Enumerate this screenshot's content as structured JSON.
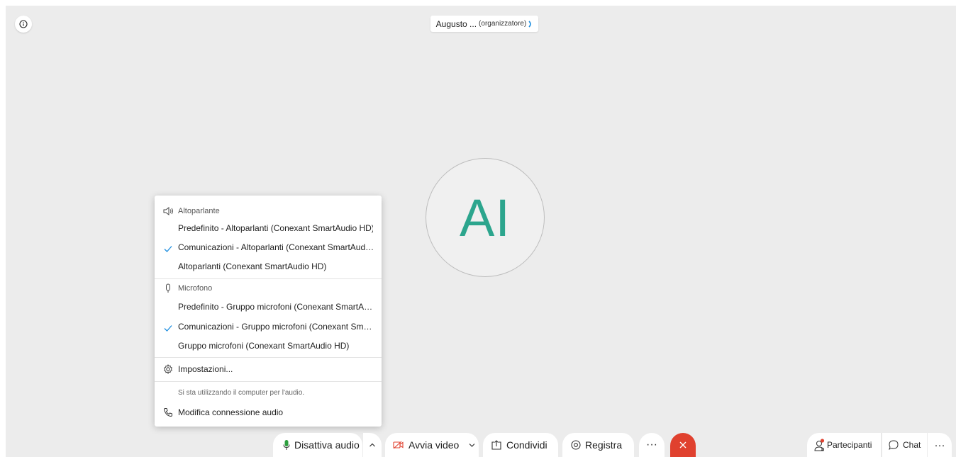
{
  "participant": {
    "name": "Augusto ...",
    "role": "(organizzatore)",
    "initials": "AI"
  },
  "audio_menu": {
    "speaker_title": "Altoparlante",
    "speakers": [
      {
        "label": "Predefinito - Altoparlanti (Conexant SmartAudio HD)",
        "selected": false
      },
      {
        "label": "Comunicazioni - Altoparlanti (Conexant SmartAud…",
        "selected": true
      },
      {
        "label": "Altoparlanti (Conexant SmartAudio HD)",
        "selected": false
      }
    ],
    "mic_title": "Microfono",
    "mics": [
      {
        "label": "Predefinito - Gruppo microfoni (Conexant SmartA…",
        "selected": false
      },
      {
        "label": "Comunicazioni - Gruppo microfoni (Conexant Sm…",
        "selected": true
      },
      {
        "label": "Gruppo microfoni (Conexant SmartAudio HD)",
        "selected": false
      }
    ],
    "settings_label": "Impostazioni...",
    "audio_note": "Si sta utilizzando il computer per l'audio.",
    "change_connection_label": "Modifica connessione audio"
  },
  "controls": {
    "mute_label": "Disattiva audio",
    "video_label": "Avvia video",
    "share_label": "Condividi",
    "record_label": "Registra",
    "more_label": "···",
    "participants_label": "Partecipanti",
    "chat_label": "Chat",
    "right_more_label": "···"
  },
  "colors": {
    "accent_check": "#1f8fe0",
    "avatar_initials": "#2ca58d",
    "mic_green": "#2e9e3e",
    "video_red": "#e0412f",
    "end_call": "#e0412f",
    "notification_dot": "#e0412f"
  }
}
